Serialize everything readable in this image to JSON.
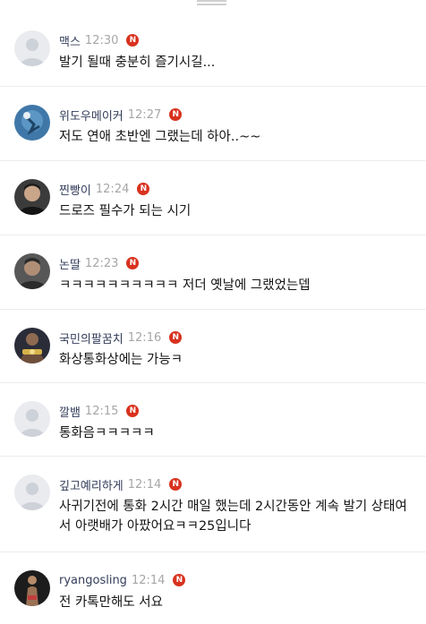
{
  "badge_label": "N",
  "colors": {
    "badge": "#d8321f",
    "name": "#333d5a",
    "time": "#a6a6a6"
  },
  "comments": [
    {
      "name": "맥스",
      "time": "12:30",
      "text": "발기 될때 충분히 즐기시길...",
      "avatar": "default-avatar"
    },
    {
      "name": "위도우메이커",
      "time": "12:27",
      "text": "저도 연애 초반엔 그랬는데 하아..~~",
      "avatar": "blue-photo-avatar"
    },
    {
      "name": "찐빵이",
      "time": "12:24",
      "text": "드로즈 필수가 되는 시기",
      "avatar": "portrait-avatar"
    },
    {
      "name": "논딸",
      "time": "12:23",
      "text": "ㅋㅋㅋㅋㅋㅋㅋㅋㅋㅋ 저더 옛날에 그랬었는뎁",
      "avatar": "portrait-avatar"
    },
    {
      "name": "국민의팔꿈치",
      "time": "12:16",
      "text": "화상통화상에는 가능ㅋ",
      "avatar": "boxer-avatar"
    },
    {
      "name": "깔뱀",
      "time": "12:15",
      "text": "통화음ㅋㅋㅋㅋㅋ",
      "avatar": "default-avatar"
    },
    {
      "name": "깊고예리하게",
      "time": "12:14",
      "text": "사귀기전에 통화 2시간 매일 했는데 2시간동안 계속 발기 상태여서 아랫배가 아팠어요ㅋㅋ25입니다",
      "avatar": "default-avatar"
    },
    {
      "name": "ryangosling",
      "time": "12:14",
      "text": "전 카톡만해도 서요",
      "avatar": "figure-avatar"
    }
  ]
}
